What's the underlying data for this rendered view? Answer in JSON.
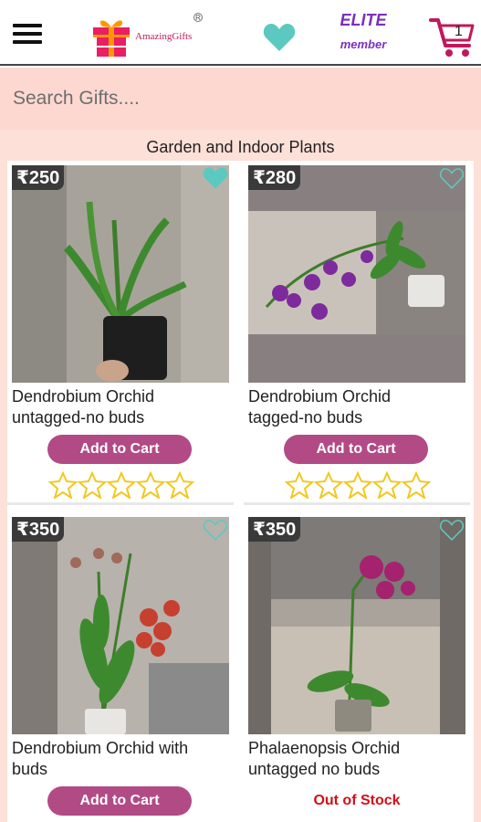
{
  "header": {
    "logo_text": "AmazingGifts",
    "logo_reg": "R",
    "elite_line1": "ELITE",
    "elite_line2": "member",
    "cart_count": "1",
    "accent_color": "#c2185b",
    "heart_color": "#5cc9c0"
  },
  "search": {
    "placeholder": "Search Gifts...."
  },
  "category": {
    "title": "Garden and Indoor Plants"
  },
  "products": [
    {
      "price": "₹250",
      "name_line1": "Dendrobium Orchid",
      "name_line2": "untagged-no buds",
      "action": "Add to Cart",
      "favorited": true,
      "rating": 0
    },
    {
      "price": "₹280",
      "name_line1": "Dendrobium Orchid",
      "name_line2": "tagged-no buds",
      "action": "Add to Cart",
      "favorited": false,
      "rating": 0
    },
    {
      "price": "₹350",
      "name_line1": "Dendrobium Orchid with",
      "name_line2": "buds",
      "action": "Add to Cart",
      "favorited": false
    },
    {
      "price": "₹350",
      "name_line1": "Phalaenopsis Orchid",
      "name_line2": "untagged no buds",
      "action": "Out of Stock",
      "favorited": false
    }
  ],
  "colors": {
    "add_to_cart": "#b24a86",
    "out_of_stock": "#d0101a",
    "search_bg": "#fdd8d0",
    "star_color": "#f2c81f"
  }
}
